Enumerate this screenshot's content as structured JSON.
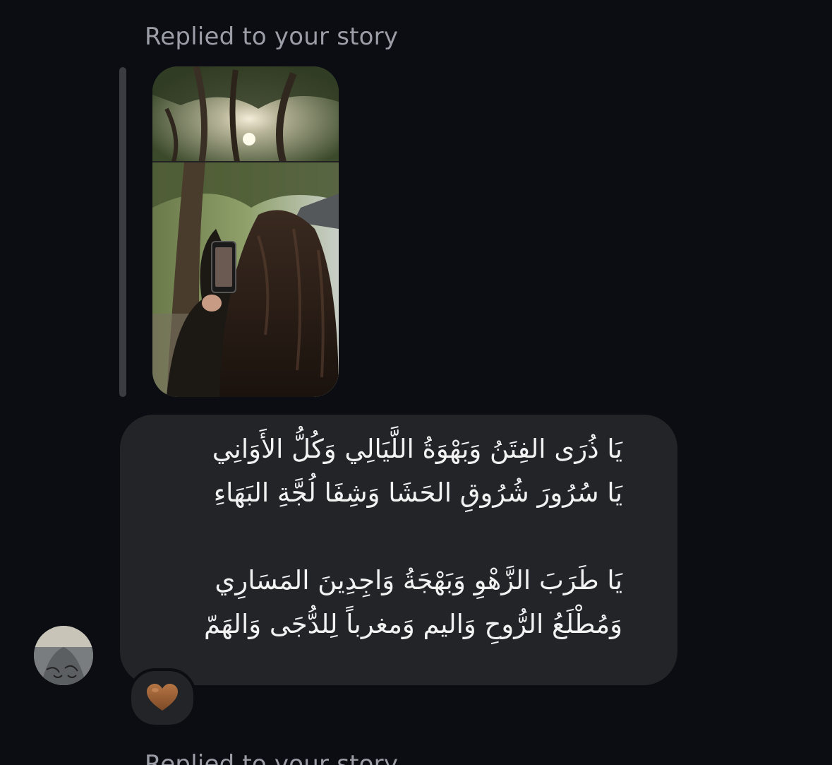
{
  "thread": {
    "replied_label": "Replied to your story",
    "replied_label_next": "Replied to your story"
  },
  "message": {
    "lines": [
      "يَا ذُرَى الفِتَنُ وَبَهْوَةُ اللَّيَالِي وَكُلُّ الأَوَانِي",
      "يَا سُرُورَ شُرُوقِ الحَشَا وَشِفَا لُجَّةِ البَهَاءِ",
      "يَا طَرَبَ الزَّهْوِ وَبَهْجَةُ وَاجِدِينَ المَسَارِي",
      "وَمُطْلَعُ الرُّوحِ وَاليم وَمغرباً لِلدُّجَى وَالهَمّ"
    ]
  },
  "story": {
    "image": "story-photo: trees with sun above; woman with long curly hair photographing with phone"
  },
  "reaction": {
    "icon": "brown-heart-icon",
    "color": "#9a5e34"
  },
  "colors": {
    "background": "#0b0d12",
    "bubble": "#222428",
    "label": "#9b9ea6",
    "text": "#f2f2f3"
  }
}
